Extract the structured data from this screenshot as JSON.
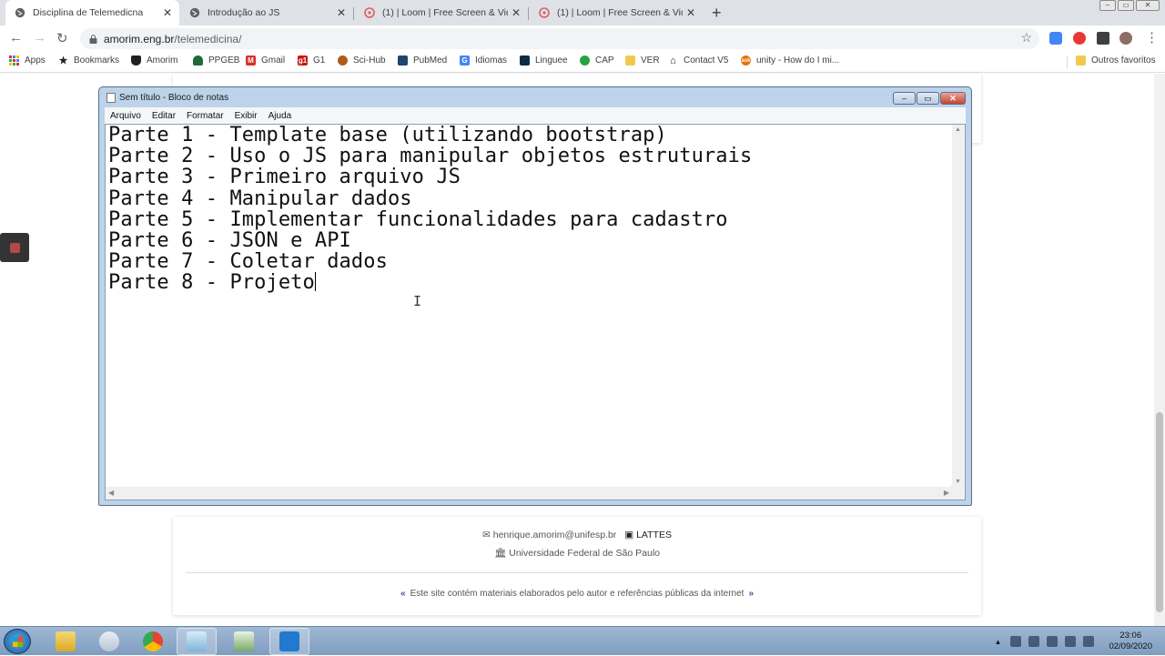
{
  "browser": {
    "tabs": [
      {
        "title": "Disciplina de Telemedicna",
        "close": "✕",
        "active": true
      },
      {
        "title": "Introdução ao JS",
        "close": "✕",
        "active": false
      },
      {
        "title": "(1) | Loom | Free Screen & Video",
        "close": "✕",
        "active": false
      },
      {
        "title": "(1) | Loom | Free Screen & Video",
        "close": "✕",
        "active": false
      }
    ],
    "new_tab": "+",
    "address": {
      "host": "amorim.eng.br",
      "path": "/telemedicina/"
    },
    "bookmarks": [
      {
        "label": "Apps",
        "icon": "apps-grid-icon",
        "color": "#d93025"
      },
      {
        "label": "Bookmarks",
        "icon": "star-icon",
        "color": "#202124"
      },
      {
        "label": "Amorim",
        "icon": "shield-icon",
        "color": "#202124"
      },
      {
        "label": "PPGEB",
        "icon": "leaf-icon",
        "color": "#1e6b3a"
      },
      {
        "label": "Gmail",
        "icon": "gmail-icon",
        "color": "#d93025"
      },
      {
        "label": "G1",
        "icon": "g1-icon",
        "color": "#c4170c"
      },
      {
        "label": "Sci-Hub",
        "icon": "scihub-icon",
        "color": "#b05a1e"
      },
      {
        "label": "PubMed",
        "icon": "pubmed-icon",
        "color": "#20456f"
      },
      {
        "label": "Idiomas",
        "icon": "translate-icon",
        "color": "#4285f4"
      },
      {
        "label": "Linguee",
        "icon": "linguee-icon",
        "color": "#0f2b46"
      },
      {
        "label": "CAP",
        "icon": "cap-icon",
        "color": "#2aa142"
      },
      {
        "label": "VER",
        "icon": "folder-icon",
        "color": "#f2c94c"
      },
      {
        "label": "Contact V5",
        "icon": "house-icon",
        "color": "#202124"
      },
      {
        "label": "unity - How do I mi...",
        "icon": "ask-icon",
        "color": "#e8710a"
      }
    ],
    "other_bookmarks": "Outros favoritos"
  },
  "notepad": {
    "title": "Sem título - Bloco de notas",
    "menu": [
      "Arquivo",
      "Editar",
      "Formatar",
      "Exibir",
      "Ajuda"
    ],
    "lines": [
      "Parte 1 - Template base (utilizando bootstrap)",
      "Parte 2 - Uso o JS para manipular objetos estruturais",
      "Parte 3 - Primeiro arquivo JS",
      "Parte 4 - Manipular dados",
      "Parte 5 - Implementar funcionalidades para cadastro",
      "Parte 6 - JSON e API",
      "Parte 7 - Coletar dados",
      "Parte 8 - Projeto"
    ]
  },
  "footer": {
    "email": "henrique.amorim@unifesp.br",
    "lattes": "LATTES",
    "university": "Universidade Federal de São Paulo",
    "notice": "Este site contém materiais elaborados pelo autor e referências públicas da internet",
    "chev_left": "«",
    "chev_right": "»"
  },
  "taskbar": {
    "time": "23:06",
    "date": "02/09/2020"
  }
}
